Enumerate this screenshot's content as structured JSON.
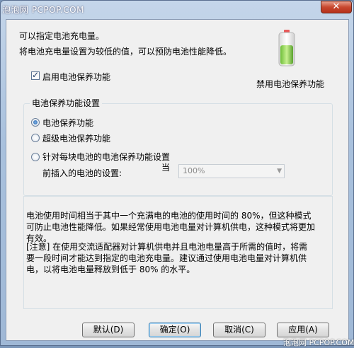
{
  "window": {
    "title": "电池保养功能",
    "watermark_top": "泡泡网 PCPOP.COM",
    "close_glyph": "✕"
  },
  "intro": {
    "line1": "可以指定电池充电量。",
    "line2": "将电池充电量设置为较低的值，可以预防电池性能降低。"
  },
  "battery": {
    "caption": "禁用电池保养功能"
  },
  "enable_checkbox": {
    "label": "启用电池保养功能",
    "checked": true
  },
  "group": {
    "title": "电池保养功能设置",
    "options": [
      {
        "label": "电池保养功能",
        "selected": true
      },
      {
        "label": "超级电池保养功能",
        "selected": false
      },
      {
        "label": "针对每块电池的电池保养功能设置",
        "selected": false
      }
    ],
    "option3_suffix": "当",
    "setting_label": "前插入的电池的设置:",
    "dropdown_value": "100%"
  },
  "info": {
    "para1": "电池使用时间相当于其中一个充满电的电池的使用时间的 80%，但这种模式可防止电池性能降低。如果经常使用电池电量对计算机供电，这种模式将更加有效。",
    "para2": "[注意] 在使用交流适配器对计算机供电并且电池电量高于所需的值时，将需要一段时间才能达到指定的电池充电量。建议通过使用电池电量对计算机供电，以将电池电量释放到低于 80% 的水平。"
  },
  "buttons": {
    "default": "默认(D)",
    "ok": "确定(O)",
    "cancel": "取消(C)",
    "apply": "应用(A)"
  },
  "watermark_bottom": "泡泡网 PCPOP.COM",
  "colors": {
    "battery_fill": "#9ad36a",
    "battery_top": "#e85b5b"
  }
}
